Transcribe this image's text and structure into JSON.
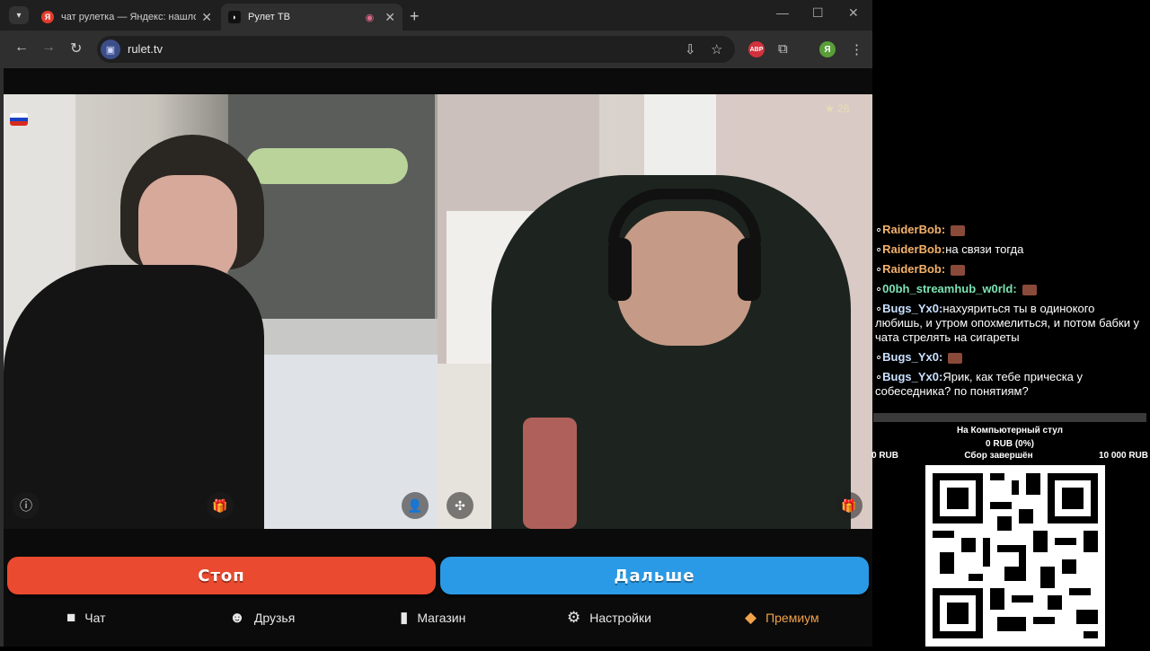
{
  "browser": {
    "tabs": [
      {
        "title": "чат рулетка — Яндекс: нашлось",
        "favicon": "Я",
        "active": false
      },
      {
        "title": "Рулет ТВ",
        "active": true
      }
    ],
    "address": "rulet.tv",
    "profile_initial": "Я",
    "abp_label": "ABP"
  },
  "videos": {
    "partner_country": "RU",
    "star_count": "26"
  },
  "actions": {
    "stop_label": "Стоп",
    "next_label": "Дальше"
  },
  "bottom_nav": {
    "chat": "Чат",
    "friends": "Друзья",
    "shop": "Магазин",
    "settings": "Настройки",
    "premium": "Премиум"
  },
  "stream_chat": [
    {
      "user": "RaiderBob:",
      "text": "",
      "color": "#f4b26a",
      "emote": true
    },
    {
      "user": "RaiderBob:",
      "text": "на связи тогда",
      "color": "#f4b26a",
      "emote": false
    },
    {
      "user": "RaiderBob:",
      "text": "",
      "color": "#f4b26a",
      "emote": true
    },
    {
      "user": "00bh_streamhub_w0rld:",
      "text": "",
      "color": "#7ce3b3",
      "emote": true
    },
    {
      "user": "Bugs_Yx0:",
      "text": "нахуяриться ты в одинокого любишь, и утром опохмелиться, и потом бабки у чата стрелять на сигареты",
      "color": "#c9e0ff",
      "emote": false
    },
    {
      "user": "Bugs_Yx0:",
      "text": "",
      "color": "#c9e0ff",
      "emote": true
    },
    {
      "user": "Bugs_Yx0:",
      "text": "Ярик, как тебе прическа у собеседника? по понятиям?",
      "color": "#c9e0ff",
      "emote": false
    }
  ],
  "donation": {
    "title": "На Компьютерный стул",
    "amount": "0 RUB (0%)",
    "min": "0 RUB",
    "status": "Сбор завершён",
    "goal": "10 000 RUB"
  }
}
